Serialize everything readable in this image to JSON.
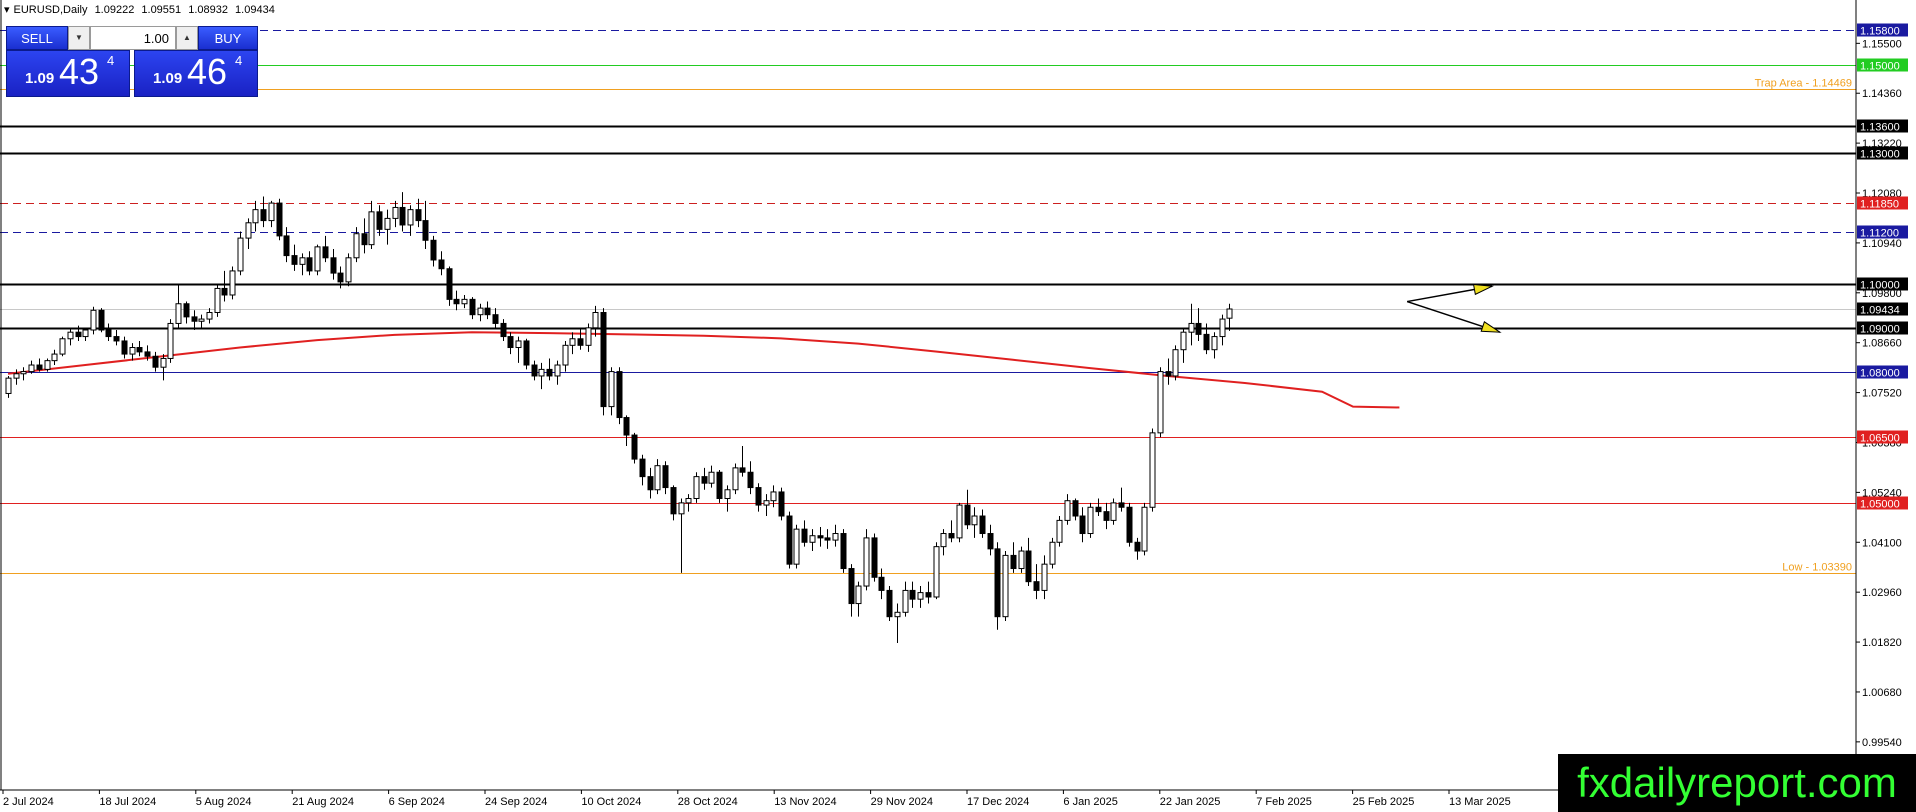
{
  "header": {
    "symbol": "EURUSD,Daily",
    "open": "1.09222",
    "high": "1.09551",
    "low": "1.08932",
    "close": "1.09434"
  },
  "trade_panel": {
    "sell_label": "SELL",
    "buy_label": "BUY",
    "lot_value": "1.00",
    "bid_prefix": "1.09",
    "bid_big": "43",
    "bid_sup": "4",
    "ask_prefix": "1.09",
    "ask_big": "46",
    "ask_sup": "4"
  },
  "watermark": "fxdailyreport.com",
  "colors": {
    "background": "#ffffff",
    "ma": "#e02020",
    "button": "#2a3ff0",
    "watermark_text": "#33ff33"
  },
  "chart_data": {
    "type": "candlestick",
    "ylim": [
      0.9844,
      1.1649
    ],
    "price_scale_labels": [
      "1.15500",
      "1.14360",
      "1.13220",
      "1.12080",
      "1.10940",
      "1.09800",
      "1.08660",
      "1.07520",
      "1.06380",
      "1.05240",
      "1.04100",
      "1.02960",
      "1.01820",
      "1.00680",
      "0.99540"
    ],
    "date_labels": [
      "2 Jul 2024",
      "18 Jul 2024",
      "5 Aug 2024",
      "21 Aug 2024",
      "6 Sep 2024",
      "24 Sep 2024",
      "10 Oct 2024",
      "28 Oct 2024",
      "13 Nov 2024",
      "29 Nov 2024",
      "17 Dec 2024",
      "6 Jan 2025",
      "22 Jan 2025",
      "7 Feb 2025",
      "25 Feb 2025",
      "13 Mar 2025"
    ],
    "levels": [
      {
        "price": 1.158,
        "label": "1.15800",
        "color": "#1a1aa0",
        "style": "dash",
        "tag_bg": "#1a1aa0",
        "tag_fg": "#ffffff"
      },
      {
        "price": 1.15,
        "label": "1.15000",
        "color": "#22cc22",
        "style": "solid",
        "tag_bg": "#22cc22",
        "tag_fg": "#ffffff"
      },
      {
        "price": 1.1446,
        "label": "Trap Area - 1.14469",
        "color": "#f0a020",
        "style": "solid",
        "tag_bg": "",
        "tag_fg": "#f0a020"
      },
      {
        "price": 1.136,
        "label": "1.13600",
        "color": "#000000",
        "style": "solid",
        "tag_bg": "#000000",
        "tag_fg": "#ffffff"
      },
      {
        "price": 1.13,
        "label": "1.13000",
        "color": "#000000",
        "style": "solid",
        "tag_bg": "#000000",
        "tag_fg": "#ffffff"
      },
      {
        "price": 1.1185,
        "label": "1.11850",
        "color": "#cc2020",
        "style": "dash",
        "tag_bg": "#e02020",
        "tag_fg": "#ffffff"
      },
      {
        "price": 1.112,
        "label": "1.11200",
        "color": "#1a1aa0",
        "style": "dash",
        "tag_bg": "#1a1aa0",
        "tag_fg": "#ffffff"
      },
      {
        "price": 1.1,
        "label": "1.10000",
        "color": "#000000",
        "style": "solid",
        "tag_bg": "#000000",
        "tag_fg": "#ffffff"
      },
      {
        "price": 1.09434,
        "label": "1.09434",
        "color": "#c8c8c8",
        "style": "solid",
        "tag_bg": "#000000",
        "tag_fg": "#ffffff"
      },
      {
        "price": 1.09,
        "label": "1.09000",
        "color": "#000000",
        "style": "solid",
        "tag_bg": "#000000",
        "tag_fg": "#ffffff"
      },
      {
        "price": 1.08,
        "label": "1.08000",
        "color": "#1a1aa0",
        "style": "solid",
        "tag_bg": "#1a1aa0",
        "tag_fg": "#ffffff"
      },
      {
        "price": 1.065,
        "label": "1.06500",
        "color": "#e02020",
        "style": "solid",
        "tag_bg": "#e02020",
        "tag_fg": "#ffffff"
      },
      {
        "price": 1.05,
        "label": "1.05000",
        "color": "#e02020",
        "style": "solid",
        "tag_bg": "#e02020",
        "tag_fg": "#ffffff"
      },
      {
        "price": 1.0339,
        "label": "Low - 1.03390",
        "color": "#f0a020",
        "style": "solid",
        "tag_bg": "",
        "tag_fg": "#f0a020"
      }
    ],
    "ma": [
      [
        0,
        1.0795
      ],
      [
        10,
        1.0815
      ],
      [
        20,
        1.0835
      ],
      [
        30,
        1.0855
      ],
      [
        40,
        1.0872
      ],
      [
        50,
        1.0884
      ],
      [
        60,
        1.089
      ],
      [
        70,
        1.0888
      ],
      [
        80,
        1.0885
      ],
      [
        90,
        1.0882
      ],
      [
        100,
        1.0876
      ],
      [
        110,
        1.0864
      ],
      [
        120,
        1.0846
      ],
      [
        130,
        1.0827
      ],
      [
        140,
        1.0808
      ],
      [
        150,
        1.079
      ],
      [
        160,
        1.0774
      ],
      [
        170,
        1.0754
      ],
      [
        174,
        1.072
      ],
      [
        180,
        1.0718
      ]
    ],
    "candles": [
      [
        1.075,
        1.079,
        1.074,
        1.0785
      ],
      [
        1.0785,
        1.0805,
        1.077,
        1.0795
      ],
      [
        1.0795,
        1.081,
        1.078,
        1.08
      ],
      [
        1.08,
        1.0825,
        1.0795,
        1.0815
      ],
      [
        1.0815,
        1.083,
        1.08,
        1.0805
      ],
      [
        1.0805,
        1.083,
        1.08,
        1.0825
      ],
      [
        1.0825,
        1.085,
        1.0815,
        1.084
      ],
      [
        1.084,
        1.088,
        1.0835,
        1.0875
      ],
      [
        1.0875,
        1.09,
        1.086,
        1.089
      ],
      [
        1.089,
        1.0905,
        1.087,
        1.088
      ],
      [
        1.088,
        1.09,
        1.087,
        1.0895
      ],
      [
        1.0895,
        1.0948,
        1.0885,
        1.094
      ],
      [
        1.094,
        1.0945,
        1.089,
        1.0895
      ],
      [
        1.0895,
        1.091,
        1.087,
        1.088
      ],
      [
        1.088,
        1.0895,
        1.086,
        1.087
      ],
      [
        1.087,
        1.088,
        1.083,
        1.084
      ],
      [
        1.084,
        1.0865,
        1.0825,
        1.0855
      ],
      [
        1.0855,
        1.087,
        1.0835,
        1.0845
      ],
      [
        1.0845,
        1.086,
        1.0825,
        1.0835
      ],
      [
        1.0835,
        1.0845,
        1.08,
        1.081
      ],
      [
        1.081,
        1.084,
        1.078,
        1.083
      ],
      [
        1.083,
        1.092,
        1.082,
        1.091
      ],
      [
        1.091,
        1.1,
        1.09,
        1.0955
      ],
      [
        1.0955,
        1.096,
        1.091,
        1.0925
      ],
      [
        1.0925,
        1.094,
        1.0895,
        1.0915
      ],
      [
        1.0915,
        1.093,
        1.09,
        1.092
      ],
      [
        1.092,
        1.0945,
        1.091,
        1.0935
      ],
      [
        1.0935,
        1.1,
        1.0925,
        1.099
      ],
      [
        1.099,
        1.103,
        1.096,
        1.0975
      ],
      [
        1.0975,
        1.104,
        1.0965,
        1.103
      ],
      [
        1.103,
        1.112,
        1.102,
        1.1105
      ],
      [
        1.1105,
        1.115,
        1.108,
        1.114
      ],
      [
        1.114,
        1.119,
        1.112,
        1.117
      ],
      [
        1.117,
        1.12,
        1.113,
        1.1145
      ],
      [
        1.1145,
        1.119,
        1.113,
        1.1185
      ],
      [
        1.1185,
        1.1195,
        1.11,
        1.111
      ],
      [
        1.111,
        1.113,
        1.105,
        1.1065
      ],
      [
        1.1065,
        1.109,
        1.103,
        1.1045
      ],
      [
        1.1045,
        1.107,
        1.102,
        1.106
      ],
      [
        1.106,
        1.1075,
        1.102,
        1.103
      ],
      [
        1.103,
        1.109,
        1.102,
        1.1085
      ],
      [
        1.1085,
        1.111,
        1.105,
        1.106
      ],
      [
        1.106,
        1.108,
        1.101,
        1.1025
      ],
      [
        1.1025,
        1.104,
        1.099,
        1.1005
      ],
      [
        1.1005,
        1.107,
        1.0995,
        1.106
      ],
      [
        1.106,
        1.113,
        1.105,
        1.1115
      ],
      [
        1.1115,
        1.115,
        1.107,
        1.109
      ],
      [
        1.109,
        1.119,
        1.108,
        1.1165
      ],
      [
        1.1165,
        1.118,
        1.111,
        1.1125
      ],
      [
        1.1125,
        1.117,
        1.109,
        1.115
      ],
      [
        1.115,
        1.119,
        1.113,
        1.1175
      ],
      [
        1.1175,
        1.121,
        1.112,
        1.1135
      ],
      [
        1.1135,
        1.118,
        1.111,
        1.117
      ],
      [
        1.117,
        1.1195,
        1.113,
        1.1145
      ],
      [
        1.1145,
        1.119,
        1.108,
        1.11
      ],
      [
        1.11,
        1.111,
        1.104,
        1.1055
      ],
      [
        1.1055,
        1.1075,
        1.102,
        1.1035
      ],
      [
        1.1035,
        1.104,
        1.095,
        1.0965
      ],
      [
        1.0965,
        1.0985,
        1.094,
        1.0955
      ],
      [
        1.0955,
        1.0975,
        1.0945,
        1.0965
      ],
      [
        1.0965,
        1.097,
        1.092,
        1.093
      ],
      [
        1.093,
        1.0955,
        1.0915,
        1.0945
      ],
      [
        1.0945,
        1.096,
        1.092,
        1.093
      ],
      [
        1.093,
        1.0945,
        1.09,
        1.091
      ],
      [
        1.091,
        1.092,
        1.087,
        1.088
      ],
      [
        1.088,
        1.089,
        1.084,
        1.0855
      ],
      [
        1.0855,
        1.088,
        1.082,
        1.087
      ],
      [
        1.087,
        1.0875,
        1.0805,
        1.0815
      ],
      [
        1.0815,
        1.0825,
        1.078,
        1.079
      ],
      [
        1.079,
        1.082,
        1.076,
        1.0805
      ],
      [
        1.0805,
        1.083,
        1.078,
        1.079
      ],
      [
        1.079,
        1.0825,
        1.077,
        1.0815
      ],
      [
        1.0815,
        1.087,
        1.08,
        1.086
      ],
      [
        1.086,
        1.089,
        1.084,
        1.0875
      ],
      [
        1.0875,
        1.09,
        1.085,
        1.086
      ],
      [
        1.086,
        1.091,
        1.0845,
        1.09
      ],
      [
        1.09,
        1.095,
        1.088,
        1.0935
      ],
      [
        1.0935,
        1.0945,
        1.07,
        1.072
      ],
      [
        1.072,
        1.081,
        1.07,
        1.08
      ],
      [
        1.08,
        1.081,
        1.068,
        1.0695
      ],
      [
        1.0695,
        1.07,
        1.063,
        1.0655
      ],
      [
        1.0655,
        1.066,
        1.059,
        1.06
      ],
      [
        1.06,
        1.061,
        1.054,
        1.056
      ],
      [
        1.056,
        1.058,
        1.051,
        1.053
      ],
      [
        1.053,
        1.06,
        1.052,
        1.0585
      ],
      [
        1.0585,
        1.0595,
        1.052,
        1.0535
      ],
      [
        1.0535,
        1.054,
        1.046,
        1.0475
      ],
      [
        1.0475,
        1.051,
        1.034,
        1.05
      ],
      [
        1.05,
        1.052,
        1.048,
        1.051
      ],
      [
        1.051,
        1.057,
        1.05,
        1.056
      ],
      [
        1.056,
        1.058,
        1.053,
        1.0545
      ],
      [
        1.0545,
        1.0585,
        1.0535,
        1.057
      ],
      [
        1.057,
        1.0575,
        1.05,
        1.051
      ],
      [
        1.051,
        1.054,
        1.048,
        1.053
      ],
      [
        1.053,
        1.059,
        1.052,
        1.058
      ],
      [
        1.058,
        1.063,
        1.056,
        1.057
      ],
      [
        1.057,
        1.0595,
        1.052,
        1.0535
      ],
      [
        1.0535,
        1.0545,
        1.048,
        1.0495
      ],
      [
        1.0495,
        1.052,
        1.047,
        1.0505
      ],
      [
        1.0505,
        1.054,
        1.049,
        1.0525
      ],
      [
        1.0525,
        1.0535,
        1.046,
        1.047
      ],
      [
        1.047,
        1.048,
        1.035,
        1.036
      ],
      [
        1.036,
        1.045,
        1.035,
        1.044
      ],
      [
        1.044,
        1.046,
        1.04,
        1.041
      ],
      [
        1.041,
        1.044,
        1.039,
        1.0425
      ],
      [
        1.0425,
        1.0445,
        1.04,
        1.042
      ],
      [
        1.042,
        1.044,
        1.0395,
        1.0415
      ],
      [
        1.0415,
        1.045,
        1.04,
        1.043
      ],
      [
        1.043,
        1.044,
        1.034,
        1.035
      ],
      [
        1.035,
        1.036,
        1.024,
        1.027
      ],
      [
        1.027,
        1.032,
        1.024,
        1.031
      ],
      [
        1.031,
        1.044,
        1.03,
        1.042
      ],
      [
        1.042,
        1.043,
        1.032,
        1.033
      ],
      [
        1.033,
        1.035,
        1.028,
        1.03
      ],
      [
        1.03,
        1.031,
        1.023,
        1.024
      ],
      [
        1.024,
        1.027,
        1.018,
        1.025
      ],
      [
        1.025,
        1.032,
        1.024,
        1.03
      ],
      [
        1.03,
        1.032,
        1.026,
        1.028
      ],
      [
        1.028,
        1.031,
        1.026,
        1.0295
      ],
      [
        1.0295,
        1.032,
        1.027,
        1.0285
      ],
      [
        1.0285,
        1.041,
        1.028,
        1.04
      ],
      [
        1.04,
        1.044,
        1.038,
        1.043
      ],
      [
        1.043,
        1.046,
        1.041,
        1.042
      ],
      [
        1.042,
        1.05,
        1.041,
        1.0495
      ],
      [
        1.0495,
        1.053,
        1.044,
        1.045
      ],
      [
        1.045,
        1.049,
        1.042,
        1.047
      ],
      [
        1.047,
        1.0485,
        1.042,
        1.043
      ],
      [
        1.043,
        1.045,
        1.038,
        1.0395
      ],
      [
        1.0395,
        1.041,
        1.021,
        1.024
      ],
      [
        1.024,
        1.039,
        1.023,
        1.038
      ],
      [
        1.038,
        1.041,
        1.034,
        1.035
      ],
      [
        1.035,
        1.04,
        1.034,
        1.039
      ],
      [
        1.039,
        1.042,
        1.031,
        1.032
      ],
      [
        1.032,
        1.036,
        1.028,
        1.03
      ],
      [
        1.03,
        1.038,
        1.028,
        1.036
      ],
      [
        1.036,
        1.042,
        1.035,
        1.041
      ],
      [
        1.041,
        1.047,
        1.04,
        1.046
      ],
      [
        1.046,
        1.052,
        1.045,
        1.0505
      ],
      [
        1.0505,
        1.051,
        1.046,
        1.047
      ],
      [
        1.047,
        1.049,
        1.041,
        1.043
      ],
      [
        1.043,
        1.05,
        1.042,
        1.049
      ],
      [
        1.049,
        1.051,
        1.047,
        1.048
      ],
      [
        1.048,
        1.05,
        1.044,
        1.046
      ],
      [
        1.046,
        1.051,
        1.045,
        1.05
      ],
      [
        1.05,
        1.0535,
        1.048,
        1.049
      ],
      [
        1.049,
        1.05,
        1.04,
        1.041
      ],
      [
        1.041,
        1.042,
        1.037,
        1.039
      ],
      [
        1.039,
        1.05,
        1.038,
        1.049
      ],
      [
        1.049,
        1.067,
        1.048,
        1.066
      ],
      [
        1.066,
        1.081,
        1.065,
        1.08
      ],
      [
        1.08,
        1.083,
        1.077,
        1.079
      ],
      [
        1.079,
        1.086,
        1.078,
        1.085
      ],
      [
        1.085,
        1.09,
        1.082,
        1.089
      ],
      [
        1.089,
        1.0955,
        1.086,
        1.091
      ],
      [
        1.091,
        1.0945,
        1.087,
        1.0885
      ],
      [
        1.0885,
        1.091,
        1.084,
        1.085
      ],
      [
        1.085,
        1.089,
        1.083,
        1.088
      ],
      [
        1.088,
        1.093,
        1.086,
        1.092
      ],
      [
        1.0922,
        1.0955,
        1.0893,
        1.0943
      ]
    ],
    "arrows": [
      {
        "from": [
          181,
          1.096
        ],
        "to": [
          192,
          1.0995
        ],
        "color": "#f0e020"
      },
      {
        "from": [
          181,
          1.096
        ],
        "to": [
          193,
          1.089
        ],
        "color": "#f0e020"
      }
    ]
  }
}
